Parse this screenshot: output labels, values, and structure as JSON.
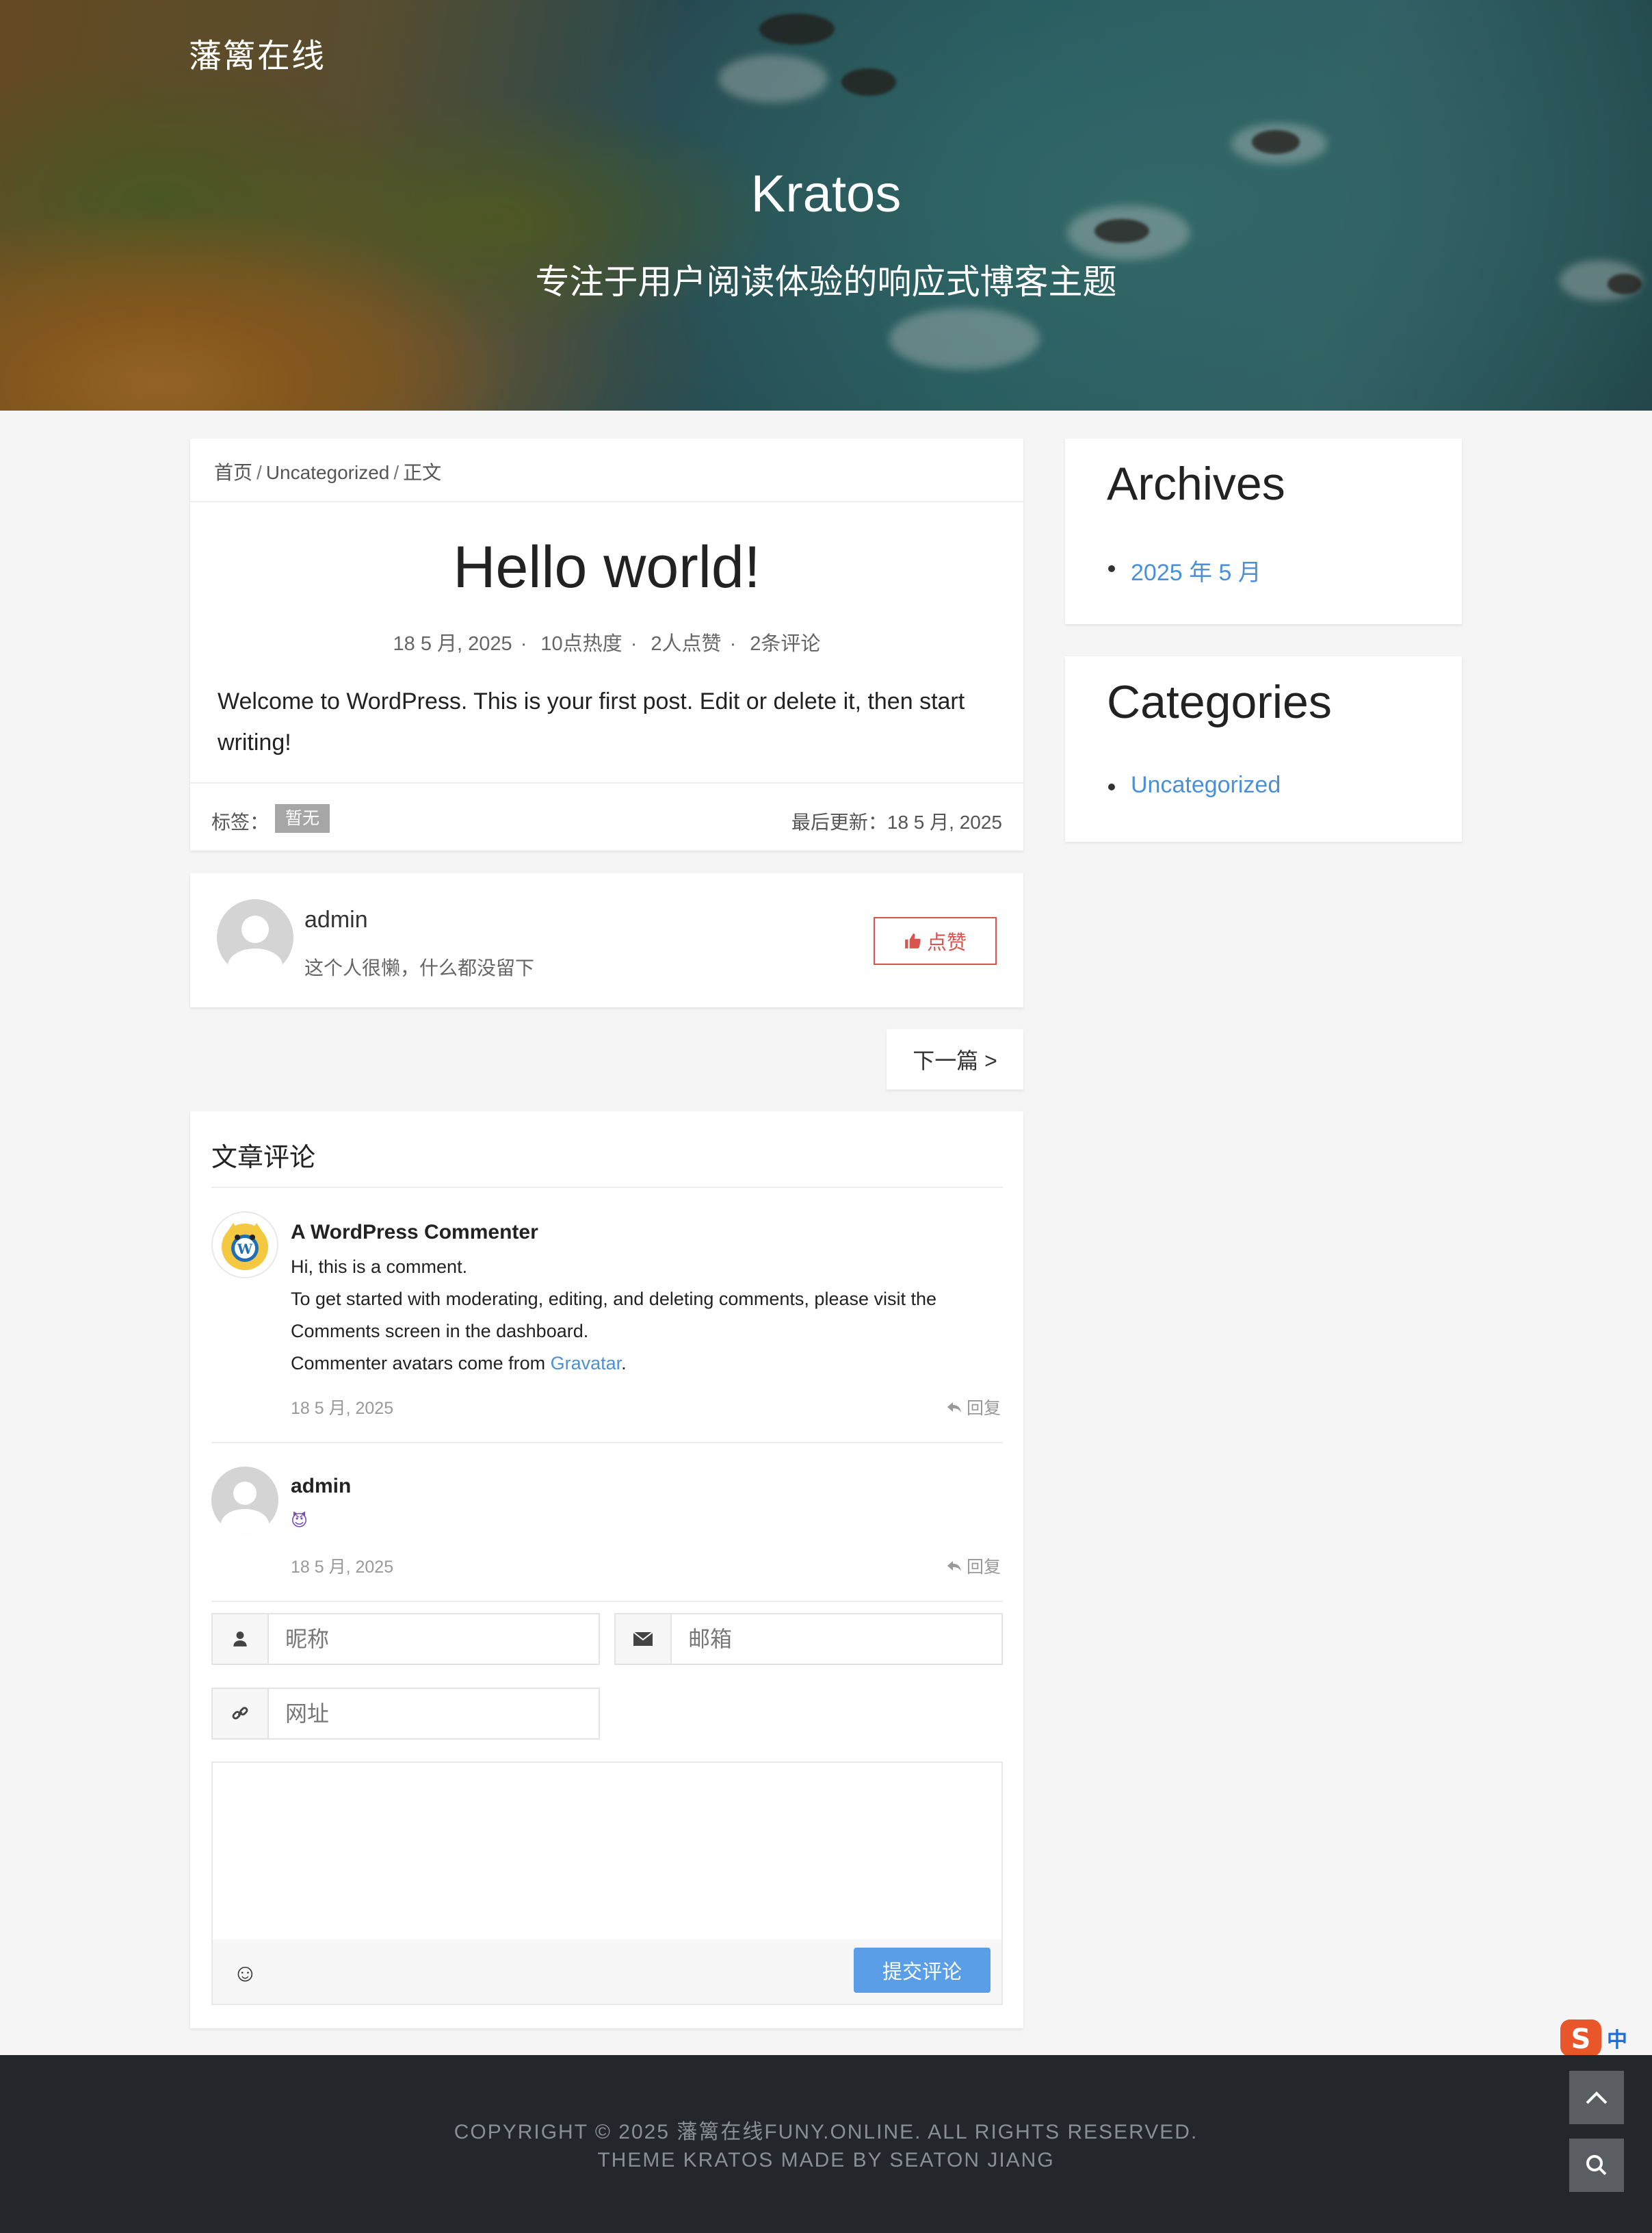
{
  "header": {
    "site_name": "藩篱在线",
    "title": "Kratos",
    "subtitle": "专注于用户阅读体验的响应式博客主题"
  },
  "breadcrumb": {
    "home": "首页",
    "sep": "/",
    "category": "Uncategorized",
    "current": "正文"
  },
  "post": {
    "title": "Hello world!",
    "date": "18 5 月, 2025",
    "views": "10点热度",
    "likes": "2人点赞",
    "comments": "2条评论",
    "meta_sep": "·",
    "body": "Welcome to WordPress. This is your first post. Edit or delete it, then start writing!",
    "tags_label": "标签：",
    "tag": "暂无",
    "updated": "最后更新：18 5 月, 2025"
  },
  "author": {
    "name": "admin",
    "bio": "这个人很懒，什么都没留下",
    "like_button": "点赞"
  },
  "pagination": {
    "next": "下一篇 >"
  },
  "comments": {
    "title": "文章评论",
    "items": [
      {
        "author": "A WordPress Commenter",
        "line1": "Hi, this is a comment.",
        "line2": "To get started with moderating, editing, and deleting comments, please visit the",
        "line3": "Comments screen in the dashboard.",
        "line4_prefix": "Commenter avatars come from ",
        "line4_link": "Gravatar",
        "line4_suffix": ".",
        "date": "18 5 月, 2025",
        "reply": "回复"
      },
      {
        "author": "admin",
        "emoji": "😈",
        "date": "18 5 月, 2025",
        "reply": "回复"
      }
    ]
  },
  "form": {
    "nickname_placeholder": "昵称",
    "email_placeholder": "邮箱",
    "url_placeholder": "网址",
    "submit": "提交评论",
    "smiley": "☺"
  },
  "sidebar": {
    "archives": {
      "title": "Archives",
      "items": [
        "2025 年 5 月"
      ]
    },
    "categories": {
      "title": "Categories",
      "items": [
        "Uncategorized"
      ]
    }
  },
  "footer": {
    "line1": "COPYRIGHT © 2025 藩篱在线FUNY.ONLINE. ALL RIGHTS RESERVED.",
    "line2": "THEME KRATOS MADE BY SEATON JIANG"
  },
  "ime": {
    "label": "中"
  },
  "colors": {
    "link": "#4a90d9",
    "like": "#d9534f",
    "submit": "#5a9ee8",
    "footer_bg": "#23262b"
  }
}
